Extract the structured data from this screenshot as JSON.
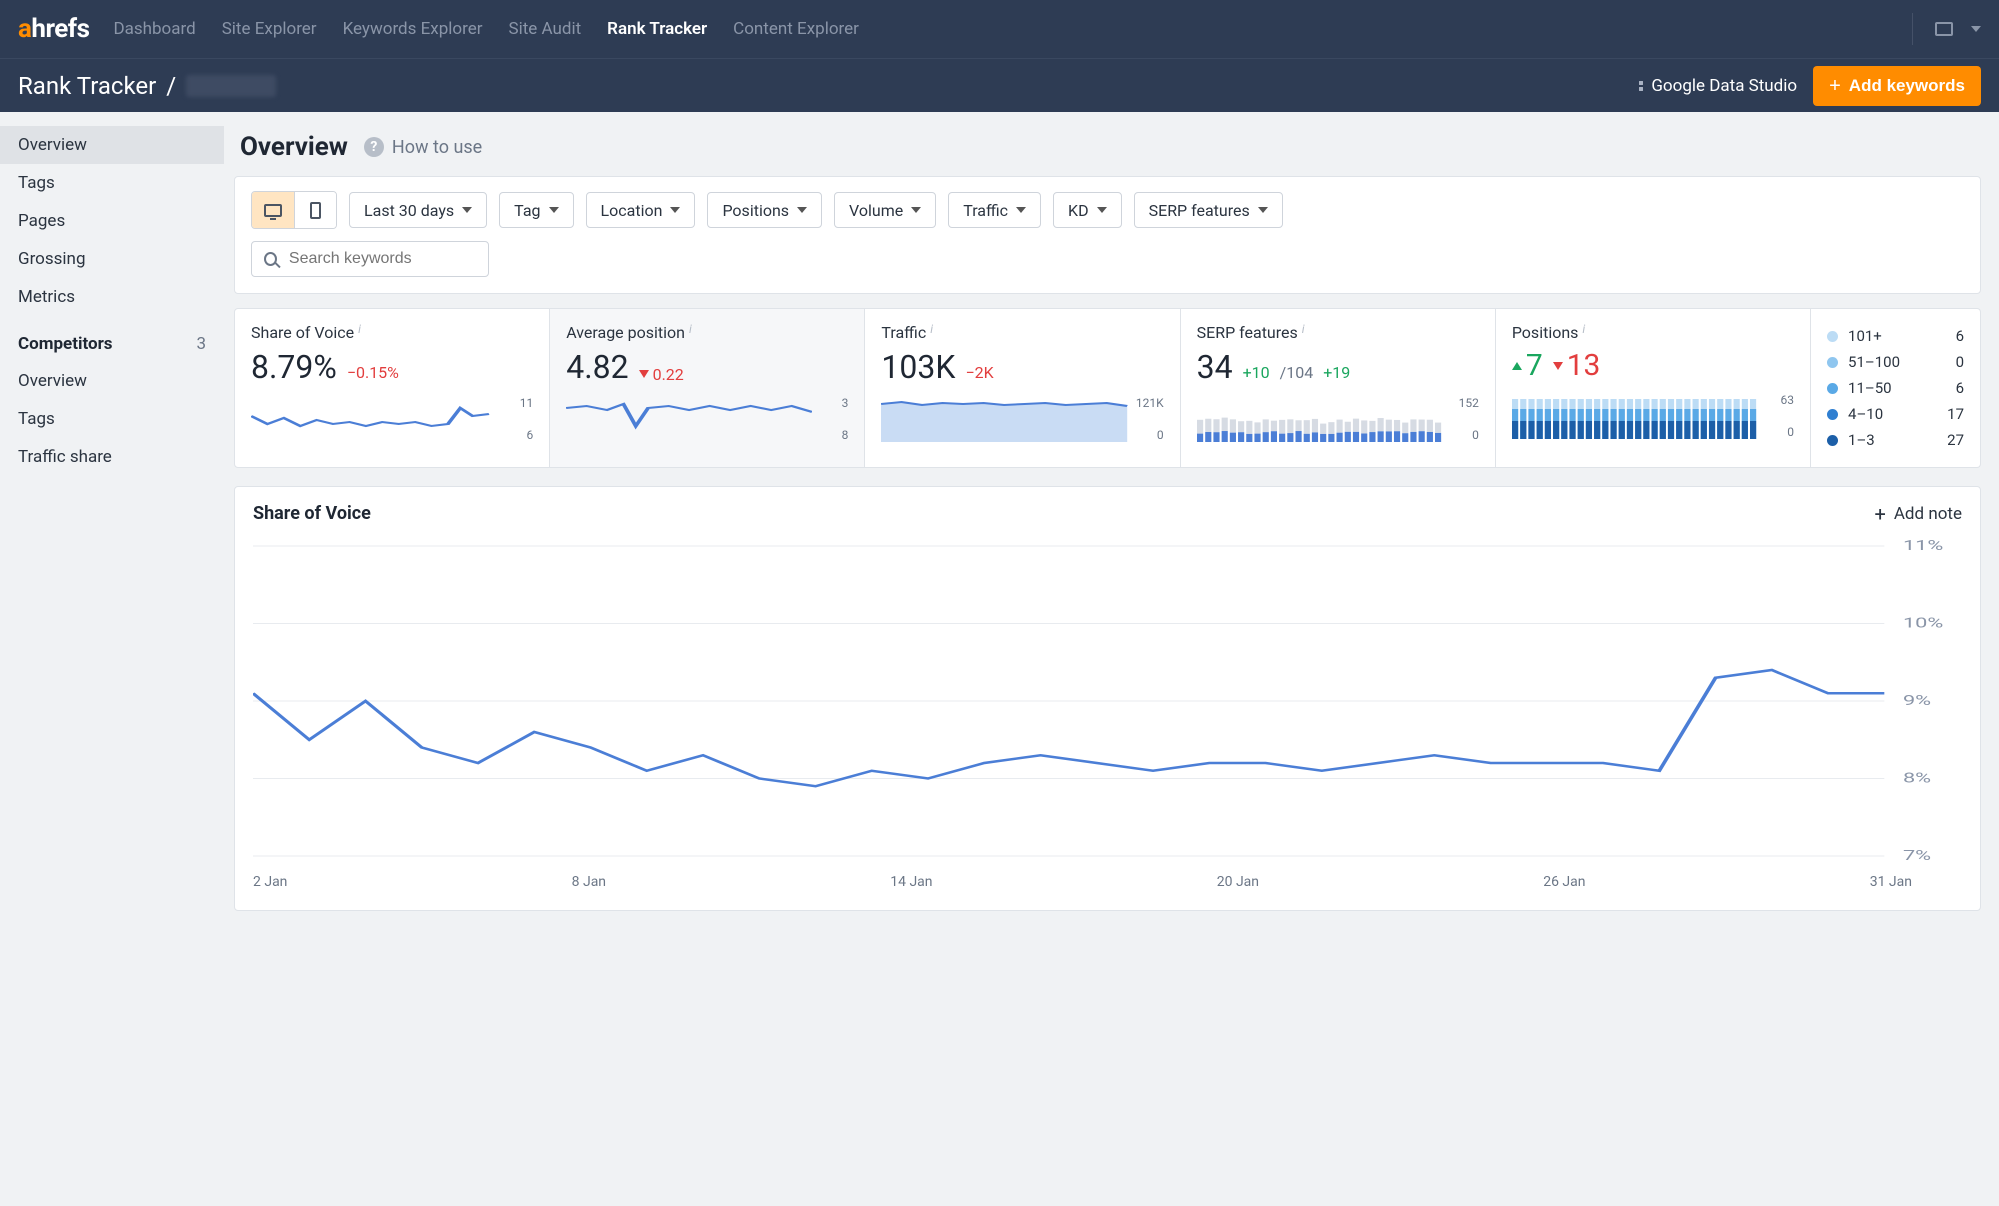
{
  "brand": {
    "pre": "a",
    "rest": "hrefs"
  },
  "topnav": [
    "Dashboard",
    "Site Explorer",
    "Keywords Explorer",
    "Site Audit",
    "Rank Tracker",
    "Content Explorer"
  ],
  "topnav_active": "Rank Tracker",
  "breadcrumb": {
    "section": "Rank Tracker",
    "sep": "/"
  },
  "actions": {
    "gds": "Google Data Studio",
    "add_kw": "Add keywords"
  },
  "sidebar": {
    "main": [
      "Overview",
      "Tags",
      "Pages",
      "Grossing",
      "Metrics"
    ],
    "active": "Overview",
    "competitors_head": "Competitors",
    "competitors_count": "3",
    "competitors": [
      "Overview",
      "Tags",
      "Traffic share"
    ]
  },
  "page": {
    "title": "Overview",
    "help": "How to use"
  },
  "filters": {
    "date": "Last 30 days",
    "pills": [
      "Tag",
      "Location",
      "Positions",
      "Volume",
      "Traffic",
      "KD",
      "SERP features"
    ],
    "search_placeholder": "Search keywords"
  },
  "metrics": {
    "sov": {
      "title": "Share of Voice",
      "value": "8.79%",
      "delta": "−0.15%",
      "top": "11",
      "bot": "6"
    },
    "avgpos": {
      "title": "Average position",
      "value": "4.82",
      "delta": "0.22",
      "top": "3",
      "bot": "8"
    },
    "traffic": {
      "title": "Traffic",
      "value": "103K",
      "delta": "−2K",
      "top": "121K",
      "bot": "0"
    },
    "serp": {
      "title": "SERP features",
      "value": "34",
      "delta_up": "+10",
      "of": "/104",
      "delta2": "+19",
      "top": "152",
      "bot": "0"
    },
    "positions": {
      "title": "Positions",
      "up": "7",
      "down": "13",
      "top": "63",
      "bot": "0"
    },
    "legend": [
      {
        "color": "#bcdcf5",
        "label": "101+",
        "count": "6"
      },
      {
        "color": "#8fc6ef",
        "label": "51–100",
        "count": "0"
      },
      {
        "color": "#5aa9e6",
        "label": "11–50",
        "count": "6"
      },
      {
        "color": "#2f7fd1",
        "label": "4–10",
        "count": "17"
      },
      {
        "color": "#1c5fa8",
        "label": "1–3",
        "count": "27"
      }
    ]
  },
  "chart_data": {
    "type": "line",
    "title": "Share of Voice",
    "ylabel": "",
    "xlabel": "",
    "ylim": [
      7,
      11
    ],
    "yticks": [
      "11%",
      "10%",
      "9%",
      "8%",
      "7%"
    ],
    "xticks": [
      "2 Jan",
      "8 Jan",
      "14 Jan",
      "20 Jan",
      "26 Jan",
      "31 Jan"
    ],
    "x": [
      2,
      3,
      4,
      5,
      6,
      7,
      8,
      9,
      10,
      11,
      12,
      13,
      14,
      15,
      16,
      17,
      18,
      19,
      20,
      21,
      22,
      23,
      24,
      25,
      26,
      27,
      28,
      29,
      30,
      31
    ],
    "values": [
      9.1,
      8.5,
      9.0,
      8.4,
      8.2,
      8.6,
      8.4,
      8.1,
      8.3,
      8.0,
      7.9,
      8.1,
      8.0,
      8.2,
      8.3,
      8.2,
      8.1,
      8.2,
      8.2,
      8.1,
      8.2,
      8.3,
      8.2,
      8.2,
      8.2,
      8.1,
      9.3,
      9.4,
      9.1,
      9.1
    ],
    "add_note": "Add note"
  }
}
